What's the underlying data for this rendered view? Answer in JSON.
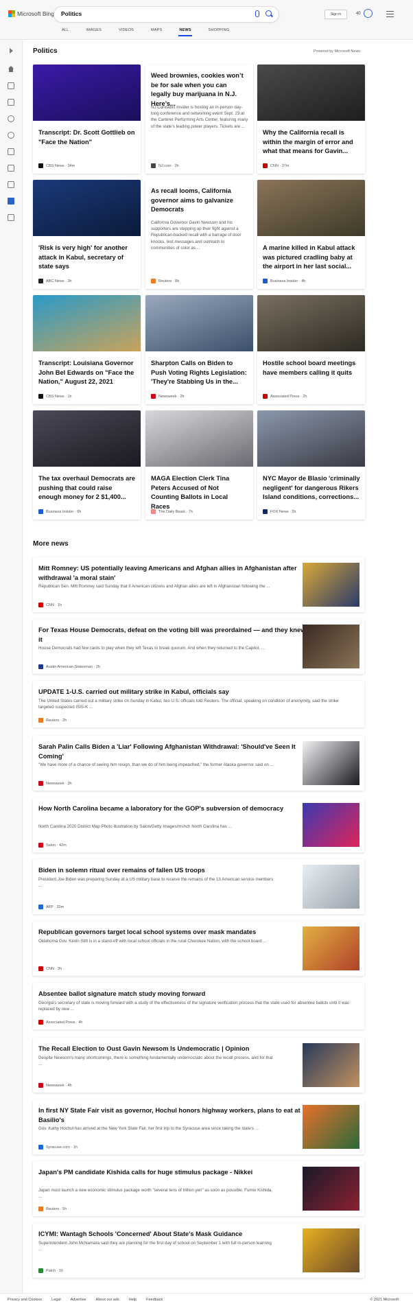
{
  "header": {
    "brand": "Microsoft Bing",
    "query": "Politics",
    "sign_in": "Sign in",
    "rewards_points": "40",
    "scopes": [
      "ALL",
      "IMAGES",
      "VIDEOS",
      "MAPS",
      "NEWS",
      "SHOPPING"
    ],
    "active_scope": "NEWS"
  },
  "sidebar": {
    "icons": [
      "expand-icon",
      "home-icon",
      "sports-icon",
      "flag-icon",
      "location-icon",
      "world-icon",
      "science-icon",
      "technology-icon",
      "entertainment-icon",
      "politics-icon",
      "money-icon"
    ],
    "active": "politics-icon"
  },
  "section": {
    "title": "Politics",
    "powered_by": "Powered by Microsoft News"
  },
  "cards": [
    {
      "title": "Transcript: Dr. Scott Gottlieb on \"Face the Nation\"",
      "source": "CBS News",
      "time": "34m",
      "src_color": "#111111",
      "img": [
        "#3b1aa8",
        "#1a0f5a"
      ]
    },
    {
      "title": "Weed brownies, cookies won’t be for sale when you can legally buy marijuana in N.J. Here’s...",
      "snippet": "NJ Cannabis Insider is hosting an in-person day-long conference and networking event Sept. 23 at the Carteret Performing Arts Center, featuring many of the state's leading power players. Tickets are ...",
      "source": "NJ.com",
      "time": "3h",
      "src_color": "#444444"
    },
    {
      "title": "Why the California recall is within the margin of error and what that means for Gavin...",
      "source": "CNN",
      "time": "37m",
      "src_color": "#cc0000",
      "img": [
        "#4a4a4a",
        "#1e1e1e"
      ]
    },
    {
      "title": "'Risk is very high' for another attack in Kabul, secretary of state says",
      "source": "ABC News",
      "time": "3h",
      "src_color": "#222222",
      "img": [
        "#1b3a7a",
        "#0b1a3a"
      ]
    },
    {
      "title": "As recall looms, California governor aims to galvanize Democrats",
      "snippet": "California Governor Gavin Newsom and his supporters are stepping up their fight against a Republican-backed recall with a barrage of door knocks, text messages and outreach to communities of color as ...",
      "source": "Reuters",
      "time": "8h",
      "src_color": "#f07a1e"
    },
    {
      "title": "A marine killed in Kabul attack was pictured cradling baby at the airport in her last social...",
      "source": "Business Insider",
      "time": "4h",
      "src_color": "#1e5ad2",
      "img": [
        "#8a7458",
        "#3e3a2a"
      ]
    },
    {
      "title": "Transcript: Louisiana Governor John Bel Edwards on \"Face the Nation,\" August 22, 2021",
      "source": "CBS News",
      "time": "1h",
      "src_color": "#111111",
      "img": [
        "#2a9ac8",
        "#c9a35a"
      ]
    },
    {
      "title": "Sharpton Calls on Biden to Push Voting Rights Legislation: 'They're Stabbing Us in the...",
      "source": "Newsweek",
      "time": "2h",
      "src_color": "#d0021b",
      "img": [
        "#9aa9bd",
        "#3c4f6a"
      ]
    },
    {
      "title": "Hostile school board meetings have members calling it quits",
      "source": "Associated Press",
      "time": "2h",
      "src_color": "#cc0000",
      "img": [
        "#7a7060",
        "#2e2a22"
      ]
    },
    {
      "title": "The tax overhaul Democrats are pushing that could raise enough money for 2 $1,400...",
      "source": "Business Insider",
      "time": "6h",
      "src_color": "#1e5ad2",
      "img": [
        "#4a4a58",
        "#1a1a22"
      ]
    },
    {
      "title": "MAGA Election Clerk Tina Peters Accused of Not Counting Ballots in Local Races",
      "source": "The Daily Beast",
      "time": "7h",
      "src_color": "#ee8888",
      "img": [
        "#d8d8dc",
        "#6a6a72"
      ]
    },
    {
      "title": "NYC Mayor de Blasio 'criminally negligent' for dangerous Rikers Island conditions, corrections...",
      "source": "FOX News",
      "time": "5h",
      "src_color": "#0a2a6a",
      "img": [
        "#8a98ac",
        "#3a3a44"
      ]
    }
  ],
  "more_news": {
    "title": "More news",
    "items": [
      {
        "title": "Mitt Romney: US potentially leaving Americans and Afghan allies in Afghanistan after withdrawal 'a moral stain'",
        "snippet": "Republican Sen. Mitt Romney said Sunday that if American citizens and Afghan allies are left in Afghanistan following the ...",
        "source": "CNN",
        "time": "1h",
        "src_color": "#cc0000",
        "img": [
          "#d8a838",
          "#2a3a6a"
        ]
      },
      {
        "title": "For Texas House Democrats, defeat on the voting bill was preordained — and they knew it",
        "snippet": "House Democrats had few cards to play when they left Texas to break quorum. And when they returned to the Capitol, ...",
        "source": "Austin American-Statesman",
        "time": "2h",
        "src_color": "#1f3a8a",
        "img": [
          "#3a2a22",
          "#8a7458"
        ]
      },
      {
        "title": "UPDATE 1-U.S. carried out military strike in Kabul, officials say",
        "snippet": "The United States carried out a military strike on Sunday in Kabul, two U.S. officials told Reuters. The official, speaking on condition of anonymity, said the strike targeted suspected ISIS-K ...",
        "source": "Reuters",
        "time": "2h",
        "src_color": "#f07a1e"
      },
      {
        "title": "Sarah Palin Calls Biden a 'Liar' Following Afghanistan Withdrawal: 'Should've Seen It Coming'",
        "snippet": "\"We have more of a chance of seeing him resign, than we do of him being impeached,\" the former Alaska governor said on ...",
        "source": "Newsweek",
        "time": "3h",
        "src_color": "#d0021b",
        "img": [
          "#f2f2f4",
          "#1a1a22"
        ]
      },
      {
        "title": "How North Carolina became a laboratory for the GOP's subversion of democracy",
        "snippet": "North Carolina 2020 District Map Photo illustration by Salon/Getty Images/mshch North Carolina has ...",
        "source": "Salon",
        "time": "42m",
        "src_color": "#d0021b",
        "img": [
          "#3a3ab0",
          "#e0245a"
        ]
      },
      {
        "title": "Biden in solemn ritual over remains of fallen US troops",
        "snippet": "President Joe Biden was preparing Sunday at a US military base to receive the remains of the 13 American service members ...",
        "source": "AFP",
        "time": "33m",
        "src_color": "#1e6ad2",
        "img": [
          "#e8eef4",
          "#9aa2ac"
        ]
      },
      {
        "title": "Republican governors target local school systems over mask mandates",
        "snippet": "Oklahoma Gov. Kevin Stitt is in a stand-off with local school officials in the rural Cherokee Nation, with the school board ...",
        "source": "CNN",
        "time": "3h",
        "src_color": "#cc0000",
        "img": [
          "#e2b040",
          "#b0402a"
        ]
      },
      {
        "title": "Absentee ballot signature match study moving forward",
        "snippet": "Georgia's secretary of state is moving forward with a study of the effectiveness of the signature verification process that the state used for absentee ballots until it was replaced by new ...",
        "source": "Associated Press",
        "time": "4h",
        "src_color": "#cc0000"
      },
      {
        "title": "The Recall Election to Oust Gavin Newsom Is Undemocratic | Opinion",
        "snippet": "Despite Newsom's many shortcomings, there is something fundamentally undemocratic about the recall process, and for that ...",
        "source": "Newsweek",
        "time": "4h",
        "src_color": "#d0021b",
        "img": [
          "#2a3a5a",
          "#c09060"
        ]
      },
      {
        "title": "In first NY State Fair visit as governor, Hochul honors highway workers, plans to eat at Basilio's",
        "snippet": "Gov. Kathy Hochul has arrived at the New York State Fair, her first trip to the Syracuse area since taking the state's ...",
        "source": "Syracuse.com",
        "time": "1h",
        "src_color": "#1e6ad2",
        "img": [
          "#e8702a",
          "#2a6a3a"
        ]
      },
      {
        "title": "Japan's PM candidate Kishida calls for huge stimulus package - Nikkei",
        "snippet": "Japan must launch a new economic stimulus package worth \"several tens of trillion yen\" as soon as possible, Fumio Kishida, ...",
        "source": "Reuters",
        "time": "5h",
        "src_color": "#f07a1e",
        "img": [
          "#1a1a2a",
          "#8a2030"
        ]
      },
      {
        "title": "ICYMI: Wantagh Schools 'Concerned' About State's Mask Guidance",
        "snippet": "Superintendent John McNamara said they are planning for the first day of school on September 1 with full in-person learning ...",
        "source": "Patch",
        "time": "1h",
        "src_color": "#2a8a3a",
        "img": [
          "#e8b020",
          "#6a4a2a"
        ]
      }
    ]
  },
  "footer": {
    "links": [
      "Privacy and Cookies",
      "Legal",
      "Advertise",
      "About our ads",
      "Help",
      "Feedback"
    ],
    "copyright": "© 2021 Microsoft"
  }
}
